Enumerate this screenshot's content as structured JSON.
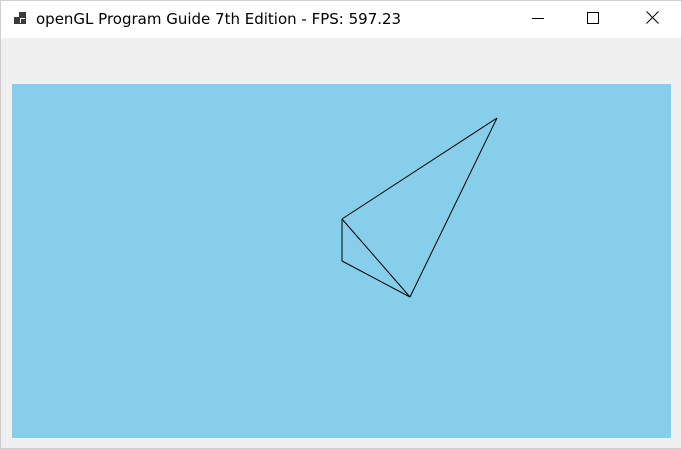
{
  "window": {
    "title": "openGL Program Guide 7th Edition - FPS: 597.23",
    "icon": "app-window-icon",
    "controls": {
      "minimize_icon": "minimize-icon",
      "maximize_icon": "maximize-icon",
      "close_icon": "close-icon"
    }
  },
  "viewport": {
    "background_color": "#87ceeb",
    "line_color": "#000000"
  }
}
